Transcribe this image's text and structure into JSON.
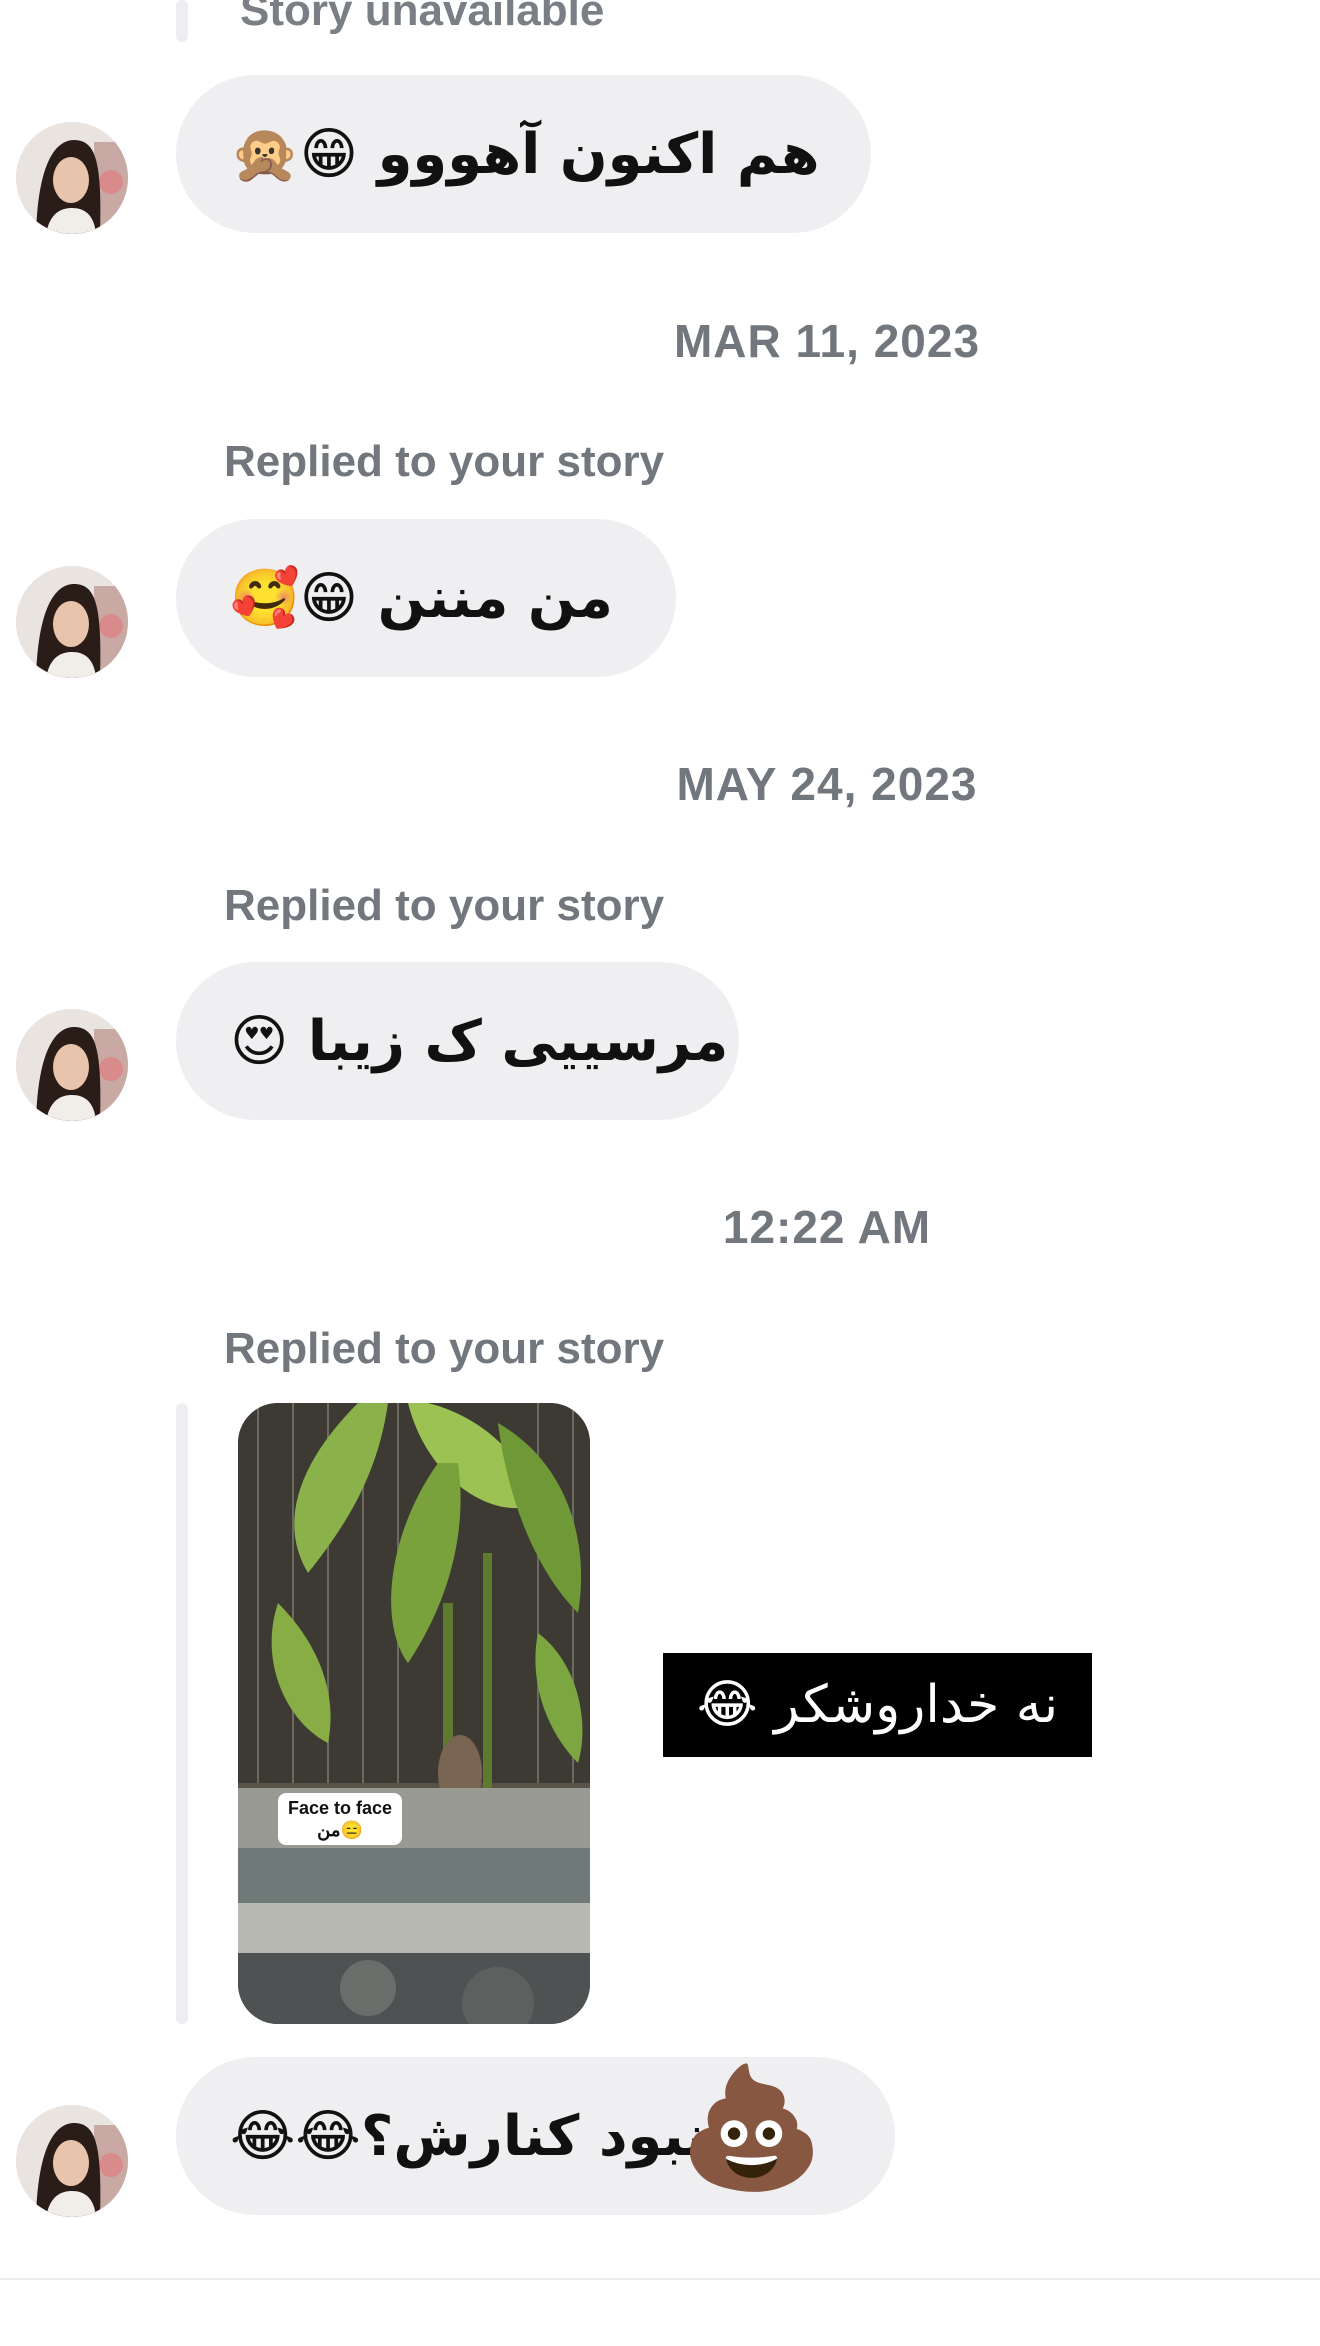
{
  "thread": {
    "top_story_label": "Story unavailable",
    "messages": [
      {
        "text": "هم اکنون آهووو 😁🙊"
      },
      {
        "date": "MAR 11, 2023",
        "reply_label": "Replied to your story",
        "text": "من مننن 😁🥰"
      },
      {
        "date": "MAY 24, 2023",
        "reply_label": "Replied to your story",
        "text": "مرسییی ک زیبا 😍"
      },
      {
        "date": "12:22 AM",
        "reply_label": "Replied to your story",
        "story": {
          "caption_line1": "Face to face",
          "caption_line2": "من😑",
          "overlay_text": "نه خداروشکر 😂"
        }
      },
      {
        "text": "عنبود کنارش؟😂😂",
        "overlay_emoji": "💩"
      }
    ]
  },
  "colors": {
    "bubble": "#efeff1",
    "meta_text": "#72767d",
    "sticker_bg": "#000000"
  }
}
